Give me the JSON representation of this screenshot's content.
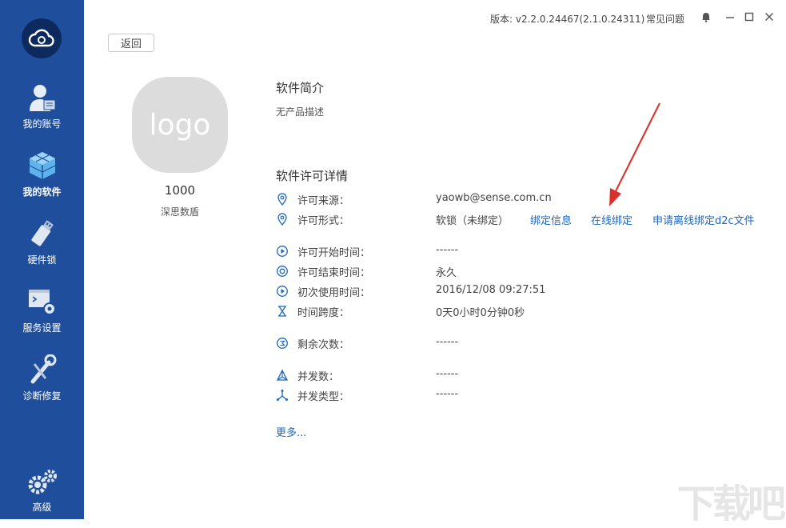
{
  "sidebar": {
    "items": [
      {
        "label": "我的账号",
        "icon": "user-icon"
      },
      {
        "label": "我的软件",
        "icon": "cubes-icon"
      },
      {
        "label": "硬件锁",
        "icon": "usb-dongle-icon"
      },
      {
        "label": "服务设置",
        "icon": "terminal-gear-icon"
      },
      {
        "label": "诊断修复",
        "icon": "wrench-icon"
      },
      {
        "label": "高级",
        "icon": "gears-icon"
      }
    ],
    "active_index": 1
  },
  "topbar": {
    "version": "版本: v2.2.0.24467(2.1.0.24311)",
    "faq": "常见问题"
  },
  "back_label": "返回",
  "app": {
    "logo_text": "logo",
    "id": "1000",
    "vendor": "深思数盾"
  },
  "intro": {
    "title": "软件简介",
    "desc": "无产品描述"
  },
  "license": {
    "title": "软件许可详情",
    "source": {
      "label": "许可来源：",
      "value": "yaowb@sense.com.cn"
    },
    "form": {
      "label": "许可形式：",
      "value": "软锁（未绑定）",
      "links": [
        "绑定信息",
        "在线绑定",
        "申请离线绑定d2c文件"
      ]
    },
    "start_time": {
      "label": "许可开始时间：",
      "value": "------"
    },
    "end_time": {
      "label": "许可结束时间：",
      "value": "永久"
    },
    "first_use": {
      "label": "初次使用时间：",
      "value": "2016/12/08 09:27:51"
    },
    "span": {
      "label": "时间跨度：",
      "value": "0天0小时0分钟0秒"
    },
    "remaining": {
      "label": "剩余次数：",
      "value": "------"
    },
    "concurrency": {
      "label": "并发数：",
      "value": "------"
    },
    "concurrency_type": {
      "label": "并发类型：",
      "value": "------"
    },
    "more": "更多..."
  },
  "watermark": "下载吧",
  "colors": {
    "sidebar": "#1f4f9c",
    "link": "#1a66c2",
    "icon": "#1a66c2",
    "arrow": "#d9302c"
  }
}
